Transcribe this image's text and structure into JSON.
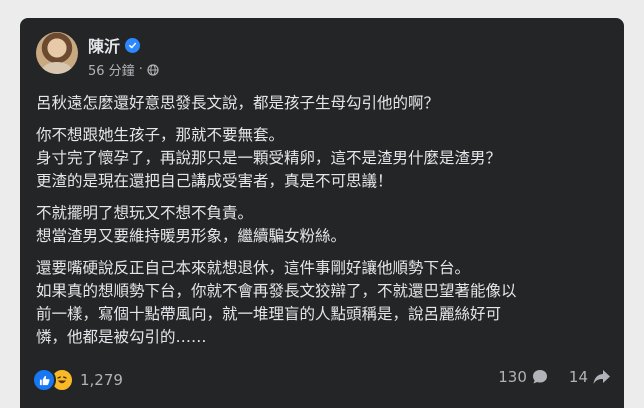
{
  "post": {
    "author": "陳沂",
    "verified_icon": "verified-badge-icon",
    "timestamp": "56 分鐘",
    "separator": "·",
    "audience_icon": "globe-icon",
    "paragraphs": [
      [
        "呂秋遠怎麼還好意思發長文說，都是孩子生母勾引他的啊？"
      ],
      [
        "你不想跟她生孩子，那就不要無套。",
        "身寸完了懷孕了，再說那只是一顆受精卵，這不是渣男什麼是渣男？",
        "更渣的是現在還把自己講成受害者，真是不可思議！"
      ],
      [
        "不就擺明了想玩又不想不負責。",
        "想當渣男又要維持暖男形象，繼續騙女粉絲。"
      ],
      [
        "還要嘴硬說反正自己本來就想退休，這件事剛好讓他順勢下台。",
        "如果真的想順勢下台，你就不會再發長文狡辯了，不就還巴望著能像以",
        "前一樣，寫個十點帶風向，就一堆理盲的人點頭稱是，說呂麗絲好可",
        "憐，他都是被勾引的……"
      ]
    ]
  },
  "footer": {
    "reaction_icons": [
      "like-icon",
      "haha-icon"
    ],
    "reaction_count": "1,279",
    "comment_count": "130",
    "share_count": "14"
  },
  "colors": {
    "card_bg": "#242526",
    "text": "#e4e6eb",
    "muted": "#b0b3b8",
    "accent": "#2d88ff",
    "page_bg": "#ececec"
  }
}
